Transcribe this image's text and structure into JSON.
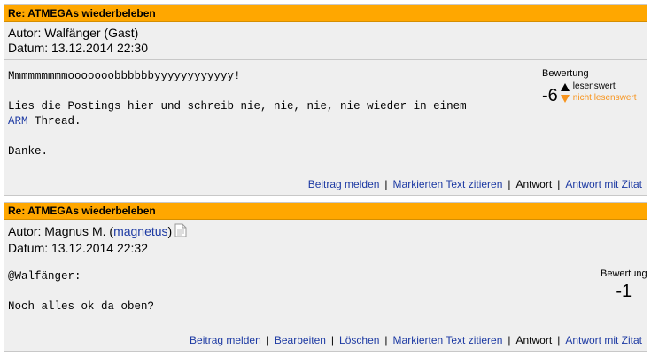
{
  "posts": [
    {
      "title": "Re: ATMEGAs wiederbeleben",
      "author_label": "Autor:",
      "author_name": "Walfänger (Gast)",
      "date_label": "Datum:",
      "date": "13.12.2014 22:30",
      "body_line1": "Mmmmmmmmmooooooobbbbbbyyyyyyyyyyyy!",
      "body_line2": "Lies die Postings hier und schreib nie, nie, nie, nie wieder in einem",
      "body_line3_link": "ARM",
      "body_line3_rest": " Thread.",
      "body_line4": "Danke.",
      "rating_label": "Bewertung",
      "rating_score": "-6",
      "vote_up_label": "lesenswert",
      "vote_down_label": "nicht lesenswert",
      "actions": {
        "report": "Beitrag melden",
        "quote_marked": "Markierten Text zitieren",
        "reply": "Antwort",
        "reply_quote": "Antwort mit Zitat"
      }
    },
    {
      "title": "Re: ATMEGAs wiederbeleben",
      "author_label": "Autor:",
      "author_name": "Magnus M.",
      "author_user_link": "magnetus",
      "date_label": "Datum:",
      "date": "13.12.2014 22:32",
      "body_line1": "@Walfänger:",
      "body_line2": "Noch alles ok da oben?",
      "rating_label": "Bewertung",
      "rating_score": "-1",
      "actions": {
        "report": "Beitrag melden",
        "edit": "Bearbeiten",
        "delete": "Löschen",
        "quote_marked": "Markierten Text zitieren",
        "reply": "Antwort",
        "reply_quote": "Antwort mit Zitat"
      }
    }
  ],
  "colors": {
    "header_bg": "#ffa700",
    "link": "#1d3aa3",
    "vote_down": "#f7941d",
    "panel_bg": "#efefef"
  }
}
